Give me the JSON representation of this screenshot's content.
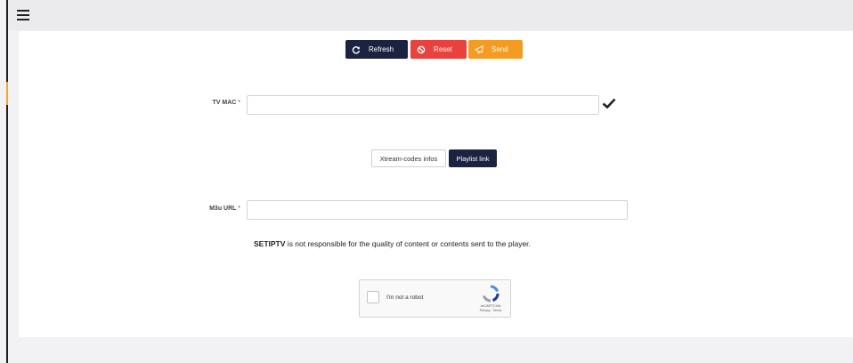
{
  "toolbar": {
    "refresh_label": "Refresh",
    "reset_label": "Reset",
    "send_label": "Send"
  },
  "form": {
    "tv_mac": {
      "label": "TV MAC",
      "required_mark": "*",
      "value": "",
      "placeholder": ""
    },
    "tabs": [
      {
        "label": "Xtream-codes infos",
        "active": false
      },
      {
        "label": "Playlist link",
        "active": true
      }
    ],
    "m3u_url": {
      "label": "M3u URL",
      "required_mark": "*",
      "value": "",
      "placeholder": ""
    }
  },
  "disclaimer": {
    "brand": "SETIPTV",
    "text": " is not responsible for the quality of content or contents sent to the player."
  },
  "captcha": {
    "label": "I'm not a robot",
    "brand": "reCAPTCHA",
    "terms": "Privacy - Terms"
  },
  "icons": {
    "menu": "hamburger-menu-icon",
    "refresh": "refresh-icon",
    "reset": "ban-icon",
    "send": "paper-plane-icon",
    "valid": "check-icon",
    "captcha": "recaptcha-logo-icon"
  },
  "colors": {
    "primary_dark": "#1c2340",
    "danger": "#e9423e",
    "warning": "#f49b22",
    "accent_bar": "#f5a623"
  }
}
